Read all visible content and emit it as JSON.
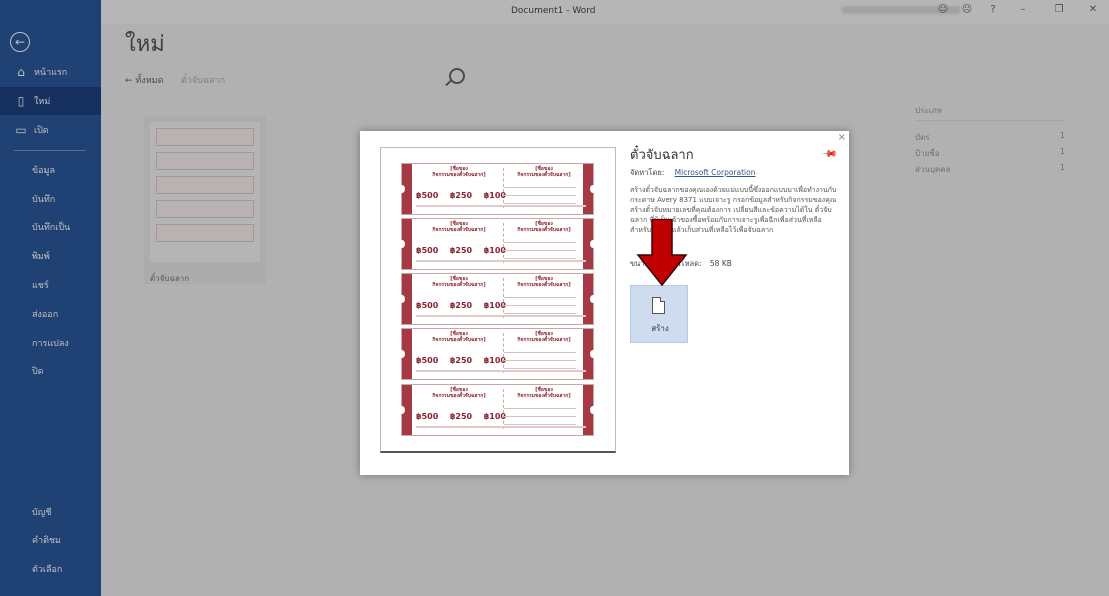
{
  "window": {
    "title": "Document1  -  Word"
  },
  "nav": {
    "home": "หน้าแรก",
    "new": "ใหม่",
    "open": "เปิด",
    "items": [
      "ข้อมูล",
      "บันทึก",
      "บันทึกเป็น",
      "พิมพ์",
      "แชร์",
      "ส่งออก",
      "การแปลง",
      "ปิด"
    ],
    "bottom": [
      "บัญชี",
      "คำติชม",
      "ตัวเลือก"
    ]
  },
  "main": {
    "title": "ใหม่",
    "home_link": "←  ทั้งหมด",
    "breadcrumb_current": "ตั๋วจับฉลาก",
    "thumb_label": "ตั๋วจับฉลาก",
    "categories_heading": "ประเภท",
    "categories": [
      {
        "name": "บัตร",
        "count": "1"
      },
      {
        "name": "ป้ายชื่อ",
        "count": "1"
      },
      {
        "name": "ส่วนบุคคล",
        "count": "1"
      }
    ]
  },
  "modal": {
    "close_glyph": "×",
    "template_title": "ตั๋วจับฉลาก",
    "provider_label": "จัดหาโดย:",
    "provider_name": "Microsoft Corporation",
    "description": "สร้างตั๋วจับฉลากของคุณเองด้วยแม่แบบนี้ซึ่งออกแบบมาเพื่อทำงานกับกระดาษ Avery 8371 แบบเจาะรู กรอกข้อมูลสำหรับกิจกรรมของคุณ สร้างตั๋วจับหมายเลขที่คุณต้องการ เปลี่ยนสีและข้อความได้ใน ตั๋วจับฉลาก ที่ผู้เป็นเจ้าของซื้อพร้อมกับการเจาะรูเพื่อฉีกเพื่อส่วนที่เหลือสำหรับการฉีกแล้วเก็บส่วนที่เหลือไว้เพื่อจับฉลาก",
    "download_label": "ขนาดการดาวน์โหลด:",
    "download_size": "58 KB",
    "create_label": "สร้าง",
    "preview": {
      "ticket_heading_1": "[ชื่อของ",
      "ticket_heading_2": "กิจกรรมของตั๋วจับฉลาก]",
      "amounts": [
        "฿500",
        "฿250",
        "฿100"
      ]
    }
  },
  "colors": {
    "nav_bg": "#2b579a",
    "ticket_red": "#a53a44",
    "arrow_red": "#c00000"
  }
}
